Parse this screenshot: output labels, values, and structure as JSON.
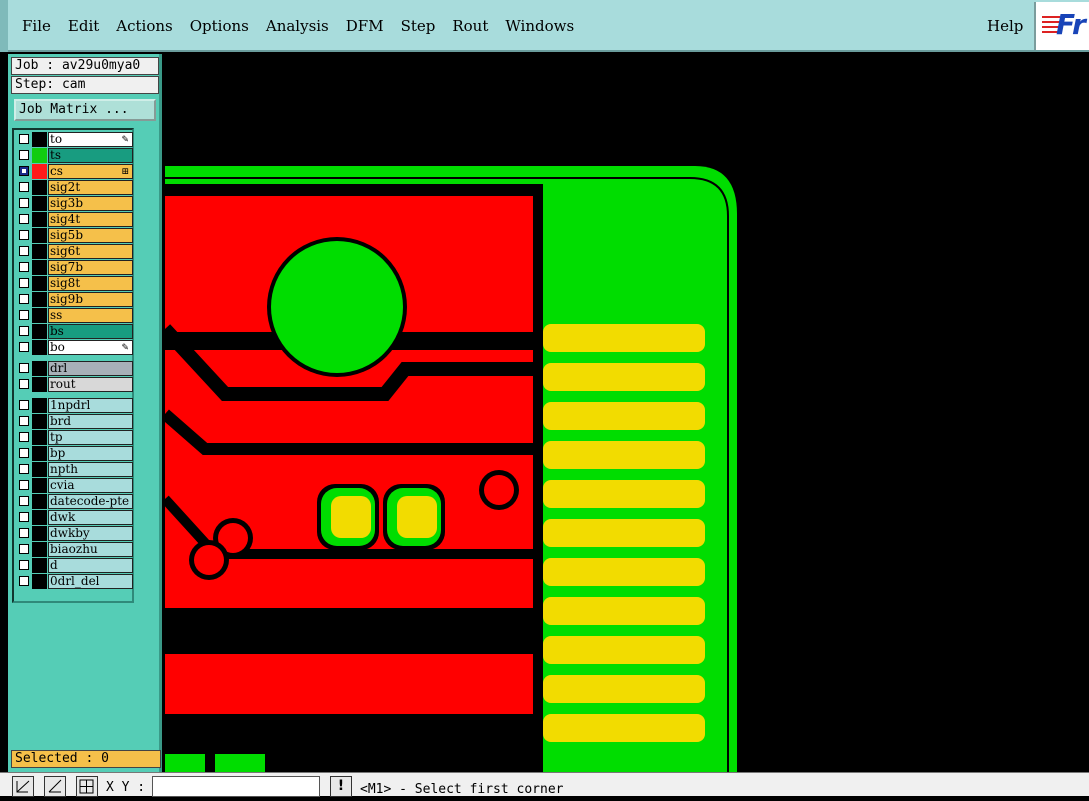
{
  "menubar": {
    "items": [
      "File",
      "Edit",
      "Actions",
      "Options",
      "Analysis",
      "DFM",
      "Step",
      "Rout",
      "Windows"
    ],
    "help": "Help",
    "logo_text": "Fr"
  },
  "panel": {
    "job": "Job : av29u0mya0",
    "step": "Step: cam",
    "job_matrix": "Job Matrix ...",
    "selected": "Selected : 0"
  },
  "layers": [
    {
      "name": "to",
      "color": "#ffffff",
      "swatch": "#000000",
      "checked": false,
      "mark": "✎"
    },
    {
      "name": "ts",
      "color": "#189c80",
      "swatch": "#11cc11",
      "checked": false,
      "mark": ""
    },
    {
      "name": "cs",
      "color": "#f5c04a",
      "swatch": "#ff1a1a",
      "checked": true,
      "mark": "⊞"
    },
    {
      "name": "sig2t",
      "color": "#f5c04a",
      "swatch": "#000000",
      "checked": false,
      "mark": ""
    },
    {
      "name": "sig3b",
      "color": "#f5c04a",
      "swatch": "#000000",
      "checked": false,
      "mark": ""
    },
    {
      "name": "sig4t",
      "color": "#f5c04a",
      "swatch": "#000000",
      "checked": false,
      "mark": ""
    },
    {
      "name": "sig5b",
      "color": "#f5c04a",
      "swatch": "#000000",
      "checked": false,
      "mark": ""
    },
    {
      "name": "sig6t",
      "color": "#f5c04a",
      "swatch": "#000000",
      "checked": false,
      "mark": ""
    },
    {
      "name": "sig7b",
      "color": "#f5c04a",
      "swatch": "#000000",
      "checked": false,
      "mark": ""
    },
    {
      "name": "sig8t",
      "color": "#f5c04a",
      "swatch": "#000000",
      "checked": false,
      "mark": ""
    },
    {
      "name": "sig9b",
      "color": "#f5c04a",
      "swatch": "#000000",
      "checked": false,
      "mark": ""
    },
    {
      "name": "ss",
      "color": "#f5c04a",
      "swatch": "#000000",
      "checked": false,
      "mark": ""
    },
    {
      "name": "bs",
      "color": "#189c80",
      "swatch": "#000000",
      "checked": false,
      "mark": ""
    },
    {
      "name": "bo",
      "color": "#ffffff",
      "swatch": "#000000",
      "checked": false,
      "mark": "✎"
    },
    {
      "name": "drl",
      "color": "#a8b0b8",
      "swatch": "#000000",
      "checked": false,
      "mark": "",
      "gap": true
    },
    {
      "name": "rout",
      "color": "#d8d8d8",
      "swatch": "#000000",
      "checked": false,
      "mark": ""
    },
    {
      "name": "1npdrl",
      "color": "#a8dcdc",
      "swatch": "#000000",
      "checked": false,
      "mark": "",
      "gap": true
    },
    {
      "name": "brd",
      "color": "#a8dcdc",
      "swatch": "#000000",
      "checked": false,
      "mark": ""
    },
    {
      "name": "tp",
      "color": "#a8dcdc",
      "swatch": "#000000",
      "checked": false,
      "mark": ""
    },
    {
      "name": "bp",
      "color": "#a8dcdc",
      "swatch": "#000000",
      "checked": false,
      "mark": ""
    },
    {
      "name": "npth",
      "color": "#a8dcdc",
      "swatch": "#000000",
      "checked": false,
      "mark": ""
    },
    {
      "name": "cvia",
      "color": "#a8dcdc",
      "swatch": "#000000",
      "checked": false,
      "mark": ""
    },
    {
      "name": "datecode-pte",
      "color": "#a8dcdc",
      "swatch": "#000000",
      "checked": false,
      "mark": ""
    },
    {
      "name": "dwk",
      "color": "#a8dcdc",
      "swatch": "#000000",
      "checked": false,
      "mark": ""
    },
    {
      "name": "dwkby",
      "color": "#a8dcdc",
      "swatch": "#000000",
      "checked": false,
      "mark": ""
    },
    {
      "name": "biaozhu",
      "color": "#a8dcdc",
      "swatch": "#000000",
      "checked": false,
      "mark": ""
    },
    {
      "name": "d",
      "color": "#a8dcdc",
      "swatch": "#000000",
      "checked": false,
      "mark": ""
    },
    {
      "name": "0drl_del",
      "color": "#a8dcdc",
      "swatch": "#000000",
      "checked": false,
      "mark": ""
    }
  ],
  "bottombar": {
    "xy_label": "X Y :",
    "xy_value": "",
    "info_icon": "!",
    "status": "<M1> - Select first corner"
  },
  "colors": {
    "copper": "#ff0000",
    "soldermask": "#00dd00",
    "gold_finger": "#f2dc00",
    "background": "#000000"
  }
}
